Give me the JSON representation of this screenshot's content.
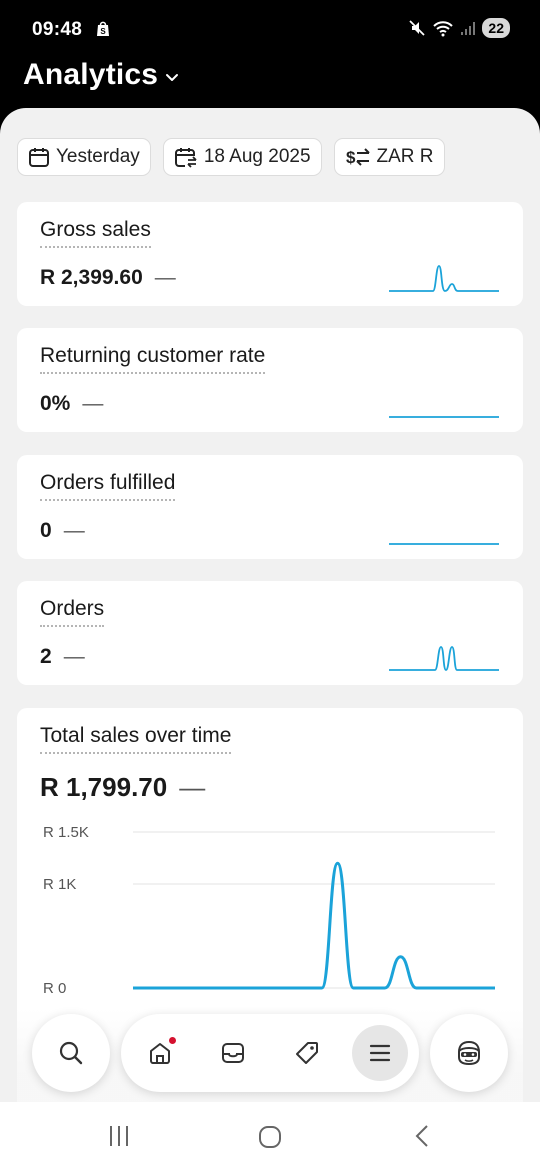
{
  "status_bar": {
    "time": "09:48",
    "battery": "22",
    "icons": [
      "shopify-bag-icon",
      "mute-icon",
      "wifi-icon",
      "signal-icon"
    ]
  },
  "header": {
    "title": "Analytics",
    "dropdown_icon": "chevron-down-icon"
  },
  "filters": {
    "date_range": {
      "label": "Yesterday",
      "icon": "calendar-icon"
    },
    "compare": {
      "label": "18 Aug 2025",
      "icon": "calendar-compare-icon"
    },
    "currency": {
      "label": "ZAR R",
      "icon": "currency-exchange-icon"
    }
  },
  "metrics": [
    {
      "title": "Gross sales",
      "value": "R 2,399.60",
      "change": "—"
    },
    {
      "title": "Returning customer rate",
      "value": "0%",
      "change": "—"
    },
    {
      "title": "Orders fulfilled",
      "value": "0",
      "change": "—"
    },
    {
      "title": "Orders",
      "value": "2",
      "change": "—"
    }
  ],
  "chart_card": {
    "title": "Total sales over time",
    "value": "R 1,799.70",
    "change": "—"
  },
  "chart_data": {
    "type": "line",
    "title": "Total sales over time",
    "y_tick_labels": [
      "R 1.5K",
      "R 1K",
      "R 0"
    ],
    "y_ticks": [
      1500,
      1000,
      0
    ],
    "ylim": [
      0,
      1500
    ],
    "x": [
      0,
      1,
      2,
      3,
      4,
      5,
      6,
      7,
      8,
      9,
      10,
      11,
      12,
      13,
      14,
      15,
      16,
      17,
      18,
      19,
      20,
      21,
      22,
      23
    ],
    "series": [
      {
        "values": [
          0,
          0,
          0,
          0,
          0,
          0,
          0,
          0,
          0,
          0,
          0,
          0,
          0,
          1200,
          0,
          0,
          0,
          300,
          0,
          0,
          0,
          0,
          0,
          0
        ]
      }
    ],
    "grid": true,
    "color": "#1ba3d9"
  },
  "bottom_nav": {
    "items": [
      "search-icon",
      "home-icon",
      "inbox-icon",
      "tag-icon",
      "menu-icon",
      "avatar-icon"
    ],
    "active": "menu-icon"
  },
  "accent_color": "#1ba3d9"
}
